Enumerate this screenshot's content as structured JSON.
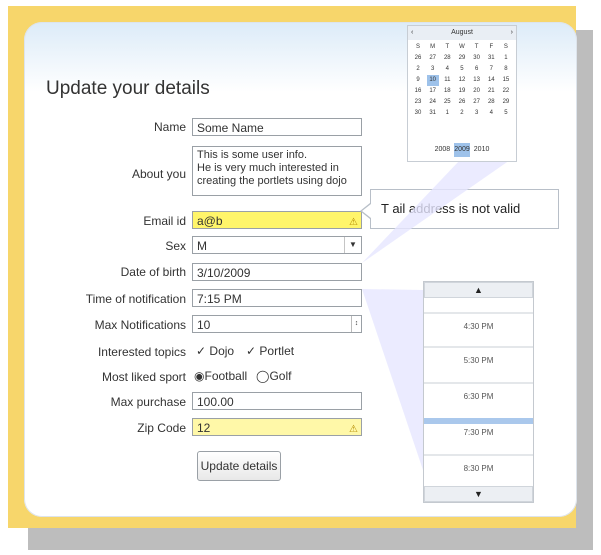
{
  "form": {
    "title": "Update your details",
    "labels": {
      "name": "Name",
      "about": "About you",
      "email": "Email id",
      "sex": "Sex",
      "dob": "Date of birth",
      "notif_time": "Time of notification",
      "max_notif": "Max Notifications",
      "topics": "Interested topics",
      "sport": "Most liked sport",
      "max_purchase": "Max purchase",
      "zip": "Zip Code"
    },
    "values": {
      "name": "Some Name",
      "about_lines": [
        "This is some user info.",
        "He is very much interested in",
        "creating the portlets using dojo"
      ],
      "email": "a@b",
      "sex": "M",
      "dob": "3/10/2009",
      "notif_time": "7:15 PM",
      "max_notif": "10",
      "topic1": "Dojo",
      "topic2": "Portlet",
      "sport1": "Football",
      "sport2": "Golf",
      "max_purchase": "100.00",
      "zip": "12"
    },
    "submit_label": "Update details"
  },
  "tooltip": {
    "text": "The email address is not valid",
    "visible_text": "T        ail address is not valid"
  },
  "calendar": {
    "month": "August",
    "weekdays": [
      "S",
      "M",
      "T",
      "W",
      "T",
      "F",
      "S"
    ],
    "weeks": [
      [
        "26",
        "27",
        "28",
        "29",
        "30",
        "31",
        "1"
      ],
      [
        "2",
        "3",
        "4",
        "5",
        "6",
        "7",
        "8"
      ],
      [
        "9",
        "10",
        "11",
        "12",
        "13",
        "14",
        "15"
      ],
      [
        "16",
        "17",
        "18",
        "19",
        "20",
        "21",
        "22"
      ],
      [
        "23",
        "24",
        "25",
        "26",
        "27",
        "28",
        "29"
      ],
      [
        "30",
        "31",
        "1",
        "2",
        "3",
        "4",
        "5"
      ]
    ],
    "selected_day": "10",
    "years": [
      "2008",
      "2009",
      "2010"
    ],
    "current_year": "2009"
  },
  "time_picker": {
    "slots": [
      "4:30 PM",
      "5:30 PM",
      "6:30 PM",
      "7:30 PM",
      "8:30 PM"
    ],
    "up_label": "▲",
    "down_label": "▼"
  },
  "icons": {
    "warning": "⚠",
    "check": "✓",
    "radio_on": "◉",
    "radio_off": "◯",
    "select_arrow": "▼",
    "spinner": "↕"
  },
  "colors": {
    "frame": "#f7d66b",
    "invalid_bg": "#fff56a",
    "warn_bg": "#fff8a8",
    "highlight": "#9ec2ea"
  }
}
